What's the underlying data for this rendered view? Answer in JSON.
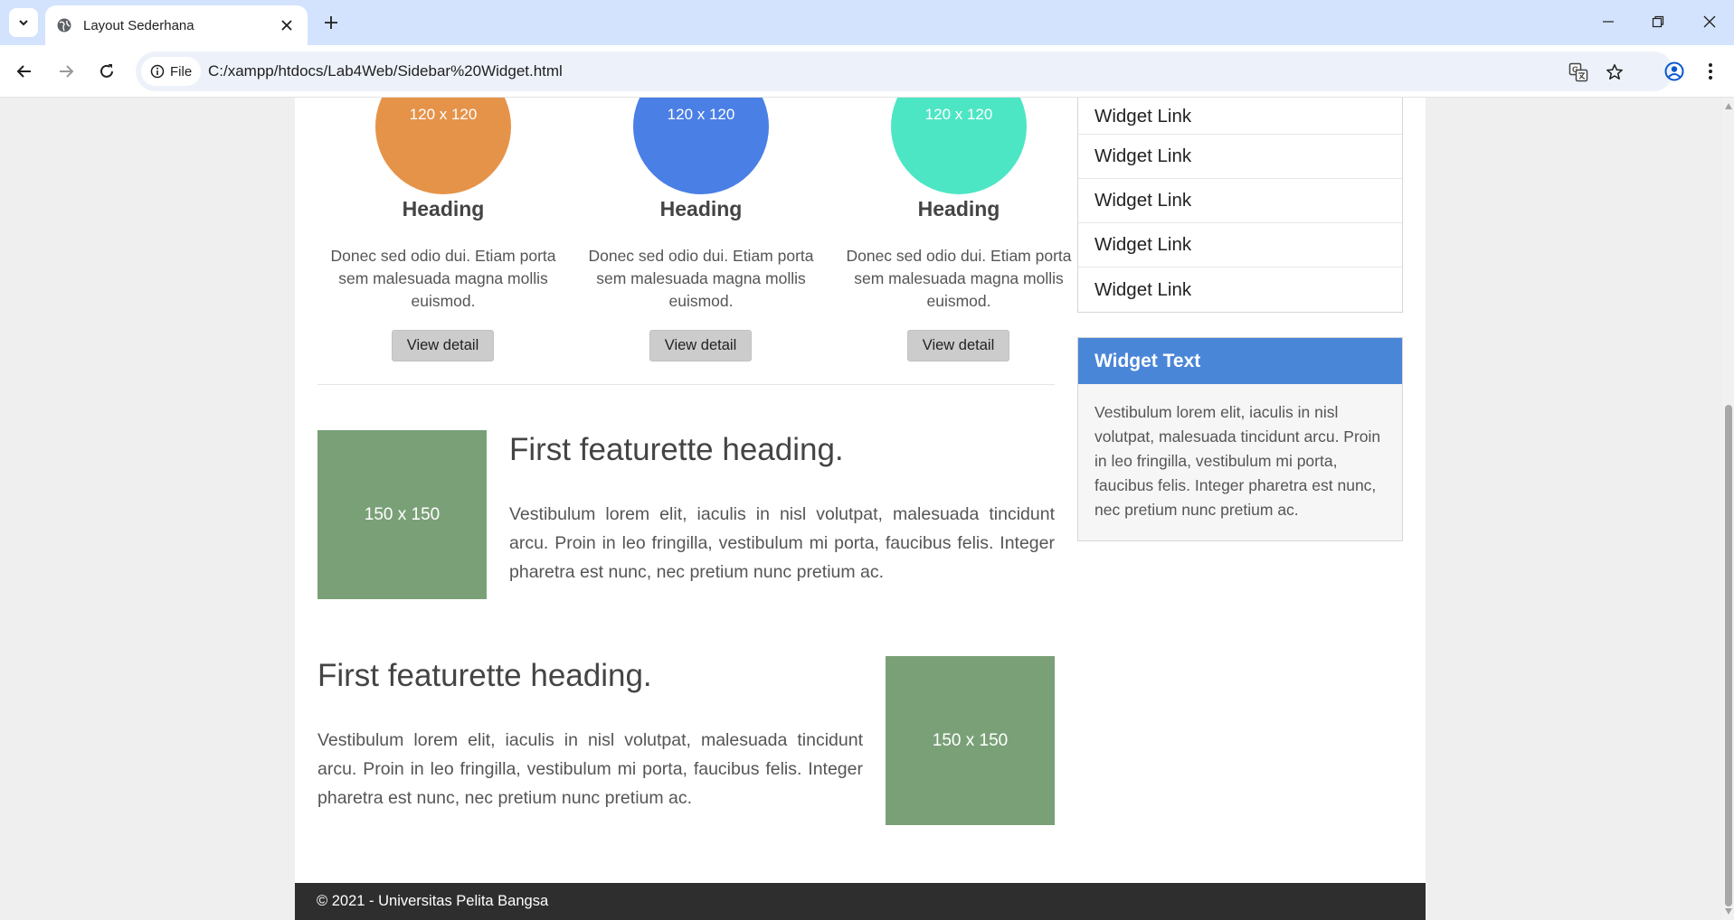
{
  "browser": {
    "tab_title": "Layout Sederhana",
    "site_chip_label": "File",
    "url": "C:/xampp/htdocs/Lab4Web/Sidebar%20Widget.html"
  },
  "colors": {
    "circle_1": "#e6934a",
    "circle_2": "#4a7fe6",
    "circle_3": "#4de6c4",
    "placeholder": "#7aa077",
    "widget_header": "#4a86d8",
    "footer": "#2e2e2e"
  },
  "columns": [
    {
      "image_label": "120 x 120",
      "heading": "Heading",
      "text": "Donec sed odio dui. Etiam porta sem malesuada magna mollis euismod.",
      "button": "View detail"
    },
    {
      "image_label": "120 x 120",
      "heading": "Heading",
      "text": "Donec sed odio dui. Etiam porta sem malesuada magna mollis euismod.",
      "button": "View detail"
    },
    {
      "image_label": "120 x 120",
      "heading": "Heading",
      "text": "Donec sed odio dui. Etiam porta sem malesuada magna mollis euismod.",
      "button": "View detail"
    }
  ],
  "featurettes": [
    {
      "image_label": "150 x 150",
      "heading": "First featurette heading.",
      "text": "Vestibulum lorem elit, iaculis in nisl volutpat, malesuada tincidunt arcu. Proin in leo fringilla, vestibulum mi porta, faucibus felis. Integer pharetra est nunc, nec pretium nunc pretium ac."
    },
    {
      "image_label": "150 x 150",
      "heading": "First featurette heading.",
      "text": "Vestibulum lorem elit, iaculis in nisl volutpat, malesuada tincidunt arcu. Proin in leo fringilla, vestibulum mi porta, faucibus felis. Integer pharetra est nunc, nec pretium nunc pretium ac."
    }
  ],
  "sidebar": {
    "links": [
      "Widget Link",
      "Widget Link",
      "Widget Link",
      "Widget Link",
      "Widget Link"
    ],
    "widget_title": "Widget Text",
    "widget_body": "Vestibulum lorem elit, iaculis in nisl volutpat, malesuada tincidunt arcu. Proin in leo fringilla, vestibulum mi porta, faucibus felis. Integer pharetra est nunc, nec pretium nunc pretium ac."
  },
  "footer": {
    "text": "© 2021 - Universitas Pelita Bangsa"
  }
}
